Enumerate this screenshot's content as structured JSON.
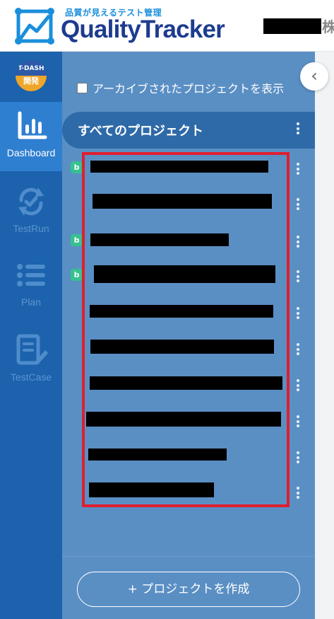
{
  "header": {
    "tagline": "品質が見えるテスト管理",
    "app_name": "QualityTracker",
    "company_suffix": "株"
  },
  "rail": {
    "workspace_badge": {
      "line1": "T-DASH",
      "line2": "開発"
    },
    "items": [
      {
        "label": "Dashboard",
        "icon": "bar-chart-icon",
        "active": true
      },
      {
        "label": "TestRun",
        "icon": "refresh-check-icon",
        "active": false
      },
      {
        "label": "Plan",
        "icon": "list-icon",
        "active": false
      },
      {
        "label": "TestCase",
        "icon": "edit-document-icon",
        "active": false
      }
    ]
  },
  "panel": {
    "archive_label": "アーカイブされたプロジェクトを表示",
    "archive_checked": false,
    "all_projects_label": "すべてのプロジェクト",
    "badge_letter": "b",
    "projects": [
      {
        "badge": true
      },
      {
        "badge": false
      },
      {
        "badge": true
      },
      {
        "badge": true
      },
      {
        "badge": false
      },
      {
        "badge": false
      },
      {
        "badge": false
      },
      {
        "badge": false
      },
      {
        "badge": false
      },
      {
        "badge": false
      }
    ],
    "create_button_label": "+ プロジェクトを作成"
  },
  "collapse_icon": "chevron-left-icon",
  "colors": {
    "rail": "#1c62ad",
    "rail_active": "#2f7fd0",
    "panel": "#5a8fc4",
    "all_row": "#2e6aa8",
    "highlight": "#e01e2e",
    "badge": "#36c28f"
  }
}
